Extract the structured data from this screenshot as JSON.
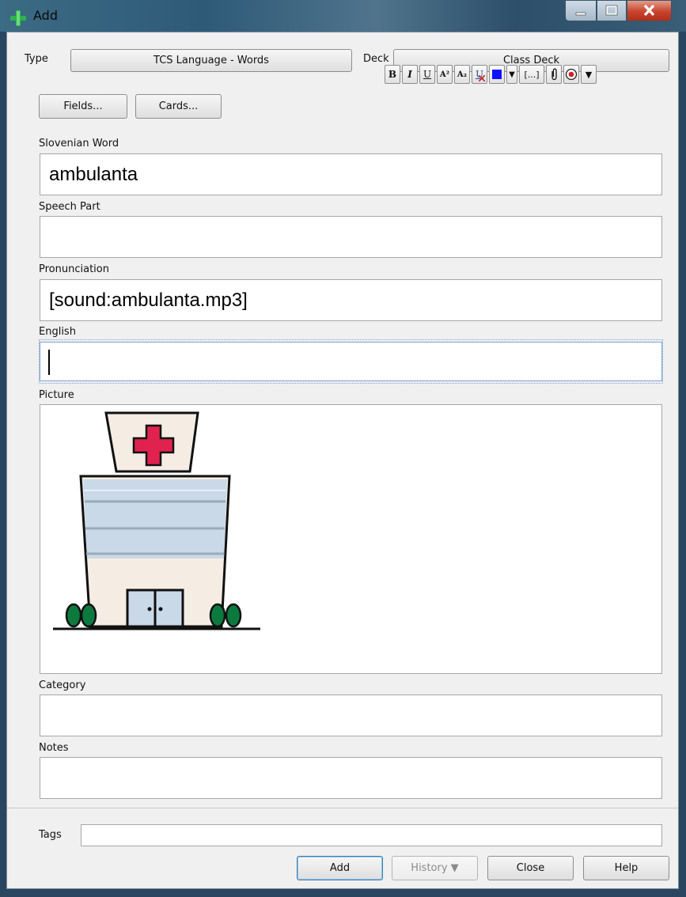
{
  "window": {
    "title": "Add"
  },
  "top": {
    "type_label": "Type",
    "type_value": "TCS Language - Words",
    "deck_label": "Deck",
    "deck_value": "Class Deck"
  },
  "buttons": {
    "fields": "Fields...",
    "cards": "Cards..."
  },
  "format_toolbar": {
    "bold": "B",
    "italic": "I",
    "underline": "U",
    "superscript": "A²",
    "subscript": "A₂",
    "clear_format": "U",
    "text_color": "#1010ff",
    "color_dropdown": "▼",
    "cloze": "[...]",
    "more_dropdown": "▼"
  },
  "fields": {
    "slovenian_word": {
      "label": "Slovenian Word",
      "value": "ambulanta"
    },
    "speech_part": {
      "label": "Speech Part",
      "value": ""
    },
    "pronunciation": {
      "label": "Pronunciation",
      "value": "[sound:ambulanta.mp3]"
    },
    "english": {
      "label": "English",
      "value": ""
    },
    "picture": {
      "label": "Picture"
    },
    "category": {
      "label": "Category",
      "value": ""
    },
    "notes": {
      "label": "Notes",
      "value": ""
    }
  },
  "tags": {
    "label": "Tags",
    "value": ""
  },
  "bottom_buttons": {
    "add": "Add",
    "history": "History ▼",
    "close": "Close",
    "help": "Help"
  },
  "colors": {
    "focus_border": "#7da2ce",
    "cross_red": "#e0234e",
    "tree_green": "#0c7a3e"
  }
}
